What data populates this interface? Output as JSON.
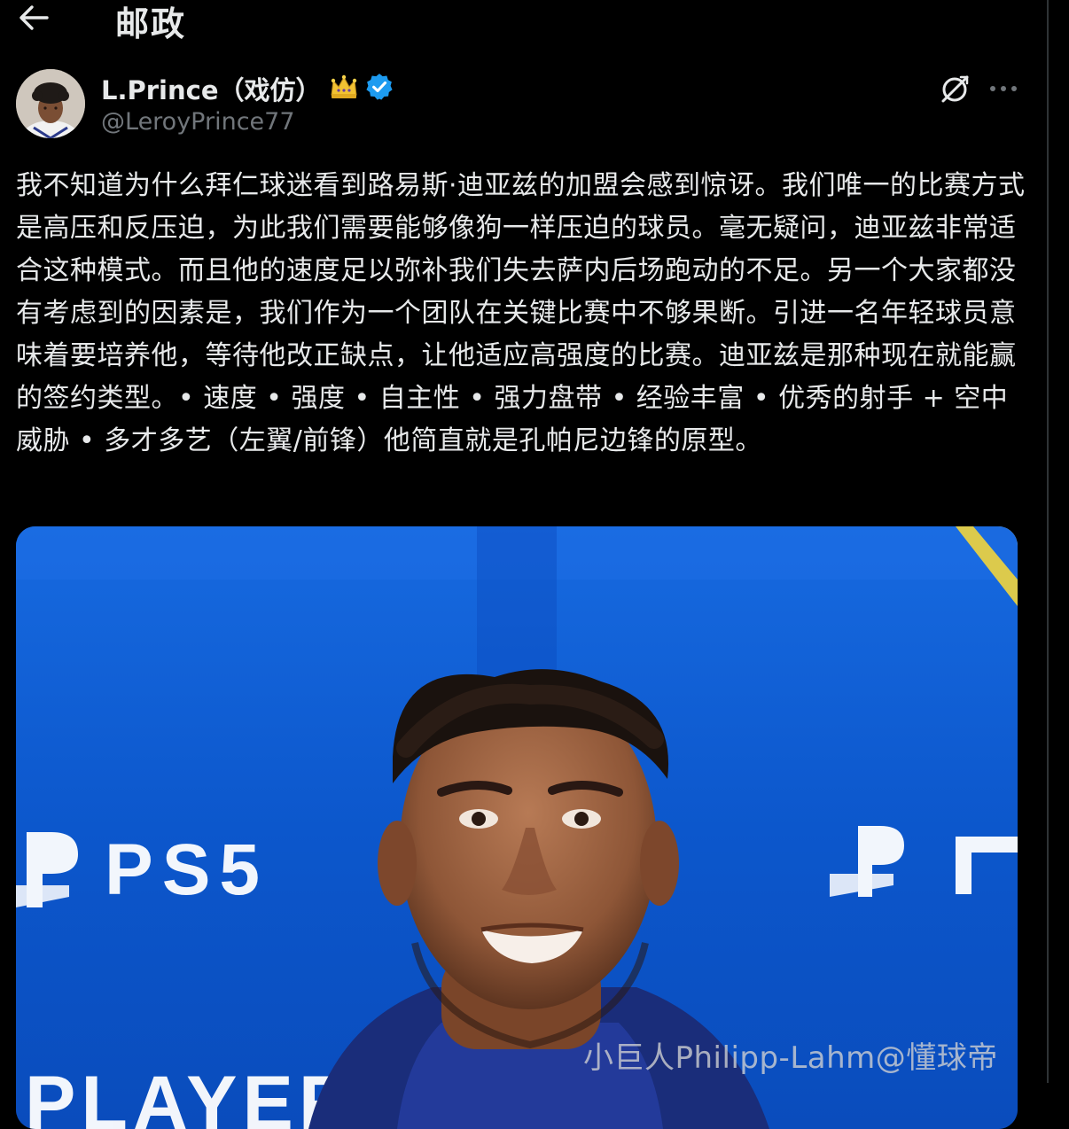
{
  "header": {
    "title": "邮政",
    "back_icon": "arrow-left-icon"
  },
  "author": {
    "display_name": "L.Prince（戏仿）",
    "handle": "@LeroyPrince77",
    "badge_icon": "crown-icon",
    "verified_icon": "verified-badge-icon",
    "verified_color": "#1d9bf0"
  },
  "actions": {
    "grok_icon": "grok-icon",
    "more_icon": "more-dots-icon"
  },
  "tweet": {
    "text": "我不知道为什么拜仁球迷看到路易斯·迪亚兹的加盟会感到惊讶。我们唯一的比赛方式是高压和反压迫，为此我们需要能够像狗一样压迫的球员。毫无疑问，迪亚兹非常适合这种模式。而且他的速度足以弥补我们失去萨内后场跑动的不足。另一个大家都没有考虑到的因素是，我们作为一个团队在关键比赛中不够果断。引进一名年轻球员意味着要培养他，等待他改正缺点，让他适应高强度的比赛。迪亚兹是那种现在就能赢的签约类型。• 速度 • 强度 • 自主性 • 强力盘带 • 经验丰富 • 优秀的射手 + 空中威胁 • 多才多艺（左翼/前锋）他简直就是孔帕尼边锋的原型。"
  },
  "media": {
    "background_color": "#0b55c9",
    "backdrop_text_left": "PS5",
    "backdrop_text_bottom": "PLAYER"
  },
  "watermark": {
    "text": "小巨人Philipp-Lahm@懂球帝"
  }
}
